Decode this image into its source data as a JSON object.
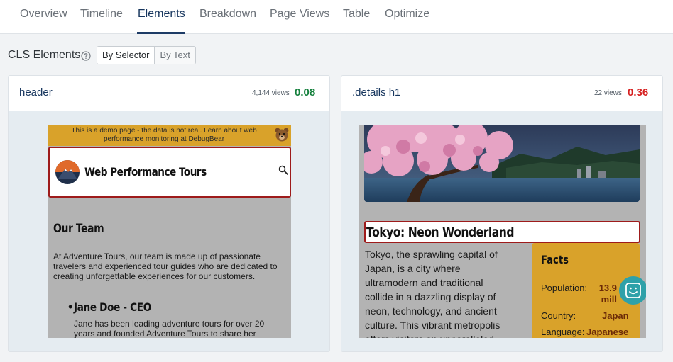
{
  "tabs": [
    {
      "label": "Overview"
    },
    {
      "label": "Timeline"
    },
    {
      "label": "Elements",
      "active": true
    },
    {
      "label": "Breakdown"
    },
    {
      "label": "Page Views"
    },
    {
      "label": "Table"
    },
    {
      "label": "Optimize"
    }
  ],
  "section": {
    "title": "CLS Elements",
    "help_icon": "question-circle-icon",
    "toggle": {
      "by_selector": "By Selector",
      "by_text": "By Text",
      "selected": "By Selector"
    }
  },
  "colors": {
    "accent": "#1d3b66",
    "good": "#15803d",
    "bad": "#d62020",
    "highlight": "#9e1b1b",
    "banner": "#d9a22a"
  },
  "cards": [
    {
      "selector": "header",
      "views": "4,144 views",
      "score": "0.08",
      "status": "good",
      "preview": {
        "banner_text": "This is a demo page - the data is not real. Learn about web performance monitoring at DebugBear",
        "site_name": "Web Performance Tours",
        "heading": "Our Team",
        "intro": "At Adventure Tours, our team is made up of passionate travelers and experienced tour guides who are dedicated to creating unforgettable experiences for our customers.",
        "person_name": "Jane Doe - CEO",
        "person_bio": "Jane has been leading adventure tours for over 20 years and founded Adventure Tours to share her passion for"
      }
    },
    {
      "selector": ".details h1",
      "views": "22 views",
      "score": "0.36",
      "status": "bad",
      "preview": {
        "headline": "Tokyo: Neon Wonderland",
        "paragraph": "Tokyo, the sprawling capital of Japan, is a city where ultramodern and traditional collide in a dazzling display of neon, technology, and ancient culture. This vibrant metropolis offers visitors an unparalleled",
        "facts_title": "Facts",
        "facts": [
          {
            "label": "Population:",
            "value": "13.9 mill"
          },
          {
            "label": "Country:",
            "value": "Japan"
          },
          {
            "label": "Language:",
            "value": "Japanese"
          }
        ]
      }
    }
  ]
}
